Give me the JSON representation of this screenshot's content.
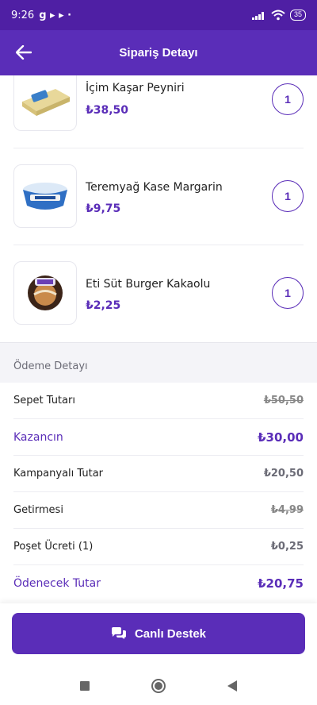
{
  "status_bar": {
    "time": "9:26",
    "app_icons": "g ▸ ▸ ·",
    "battery": "35"
  },
  "header": {
    "title": "Sipariş Detayı"
  },
  "items": [
    {
      "name": "İçim Kaşar Peyniri",
      "price": "₺38,50",
      "quantity": "1",
      "image": "cheese-package"
    },
    {
      "name": "Teremyağ Kase Margarin",
      "price": "₺9,75",
      "quantity": "1",
      "image": "margarine-tub"
    },
    {
      "name": "Eti Süt Burger Kakaolu",
      "price": "₺2,25",
      "quantity": "1",
      "image": "cake-snack"
    }
  ],
  "payment": {
    "section_title": "Ödeme Detayı",
    "rows": [
      {
        "label": "Sepet Tutarı",
        "value": "₺50,50",
        "strikethrough": true
      },
      {
        "label": "Kazancın",
        "value": "₺30,00",
        "accent": true
      },
      {
        "label": "Kampanyalı Tutar",
        "value": "₺20,50"
      },
      {
        "label": "Getirmesi",
        "value": "₺4,99",
        "strikethrough": true
      },
      {
        "label": "Poşet Ücreti (1)",
        "value": "₺0,25"
      },
      {
        "label": "Ödenecek Tutar",
        "value": "₺20,75",
        "accent": true
      }
    ]
  },
  "support_button": {
    "label": "Canlı Destek",
    "icon": "chat-bubbles-icon"
  },
  "colors": {
    "brand": "#5a2db8",
    "status_bar": "#4f1fa4",
    "divider": "#ececf1",
    "section_bg": "#f4f4f8"
  }
}
